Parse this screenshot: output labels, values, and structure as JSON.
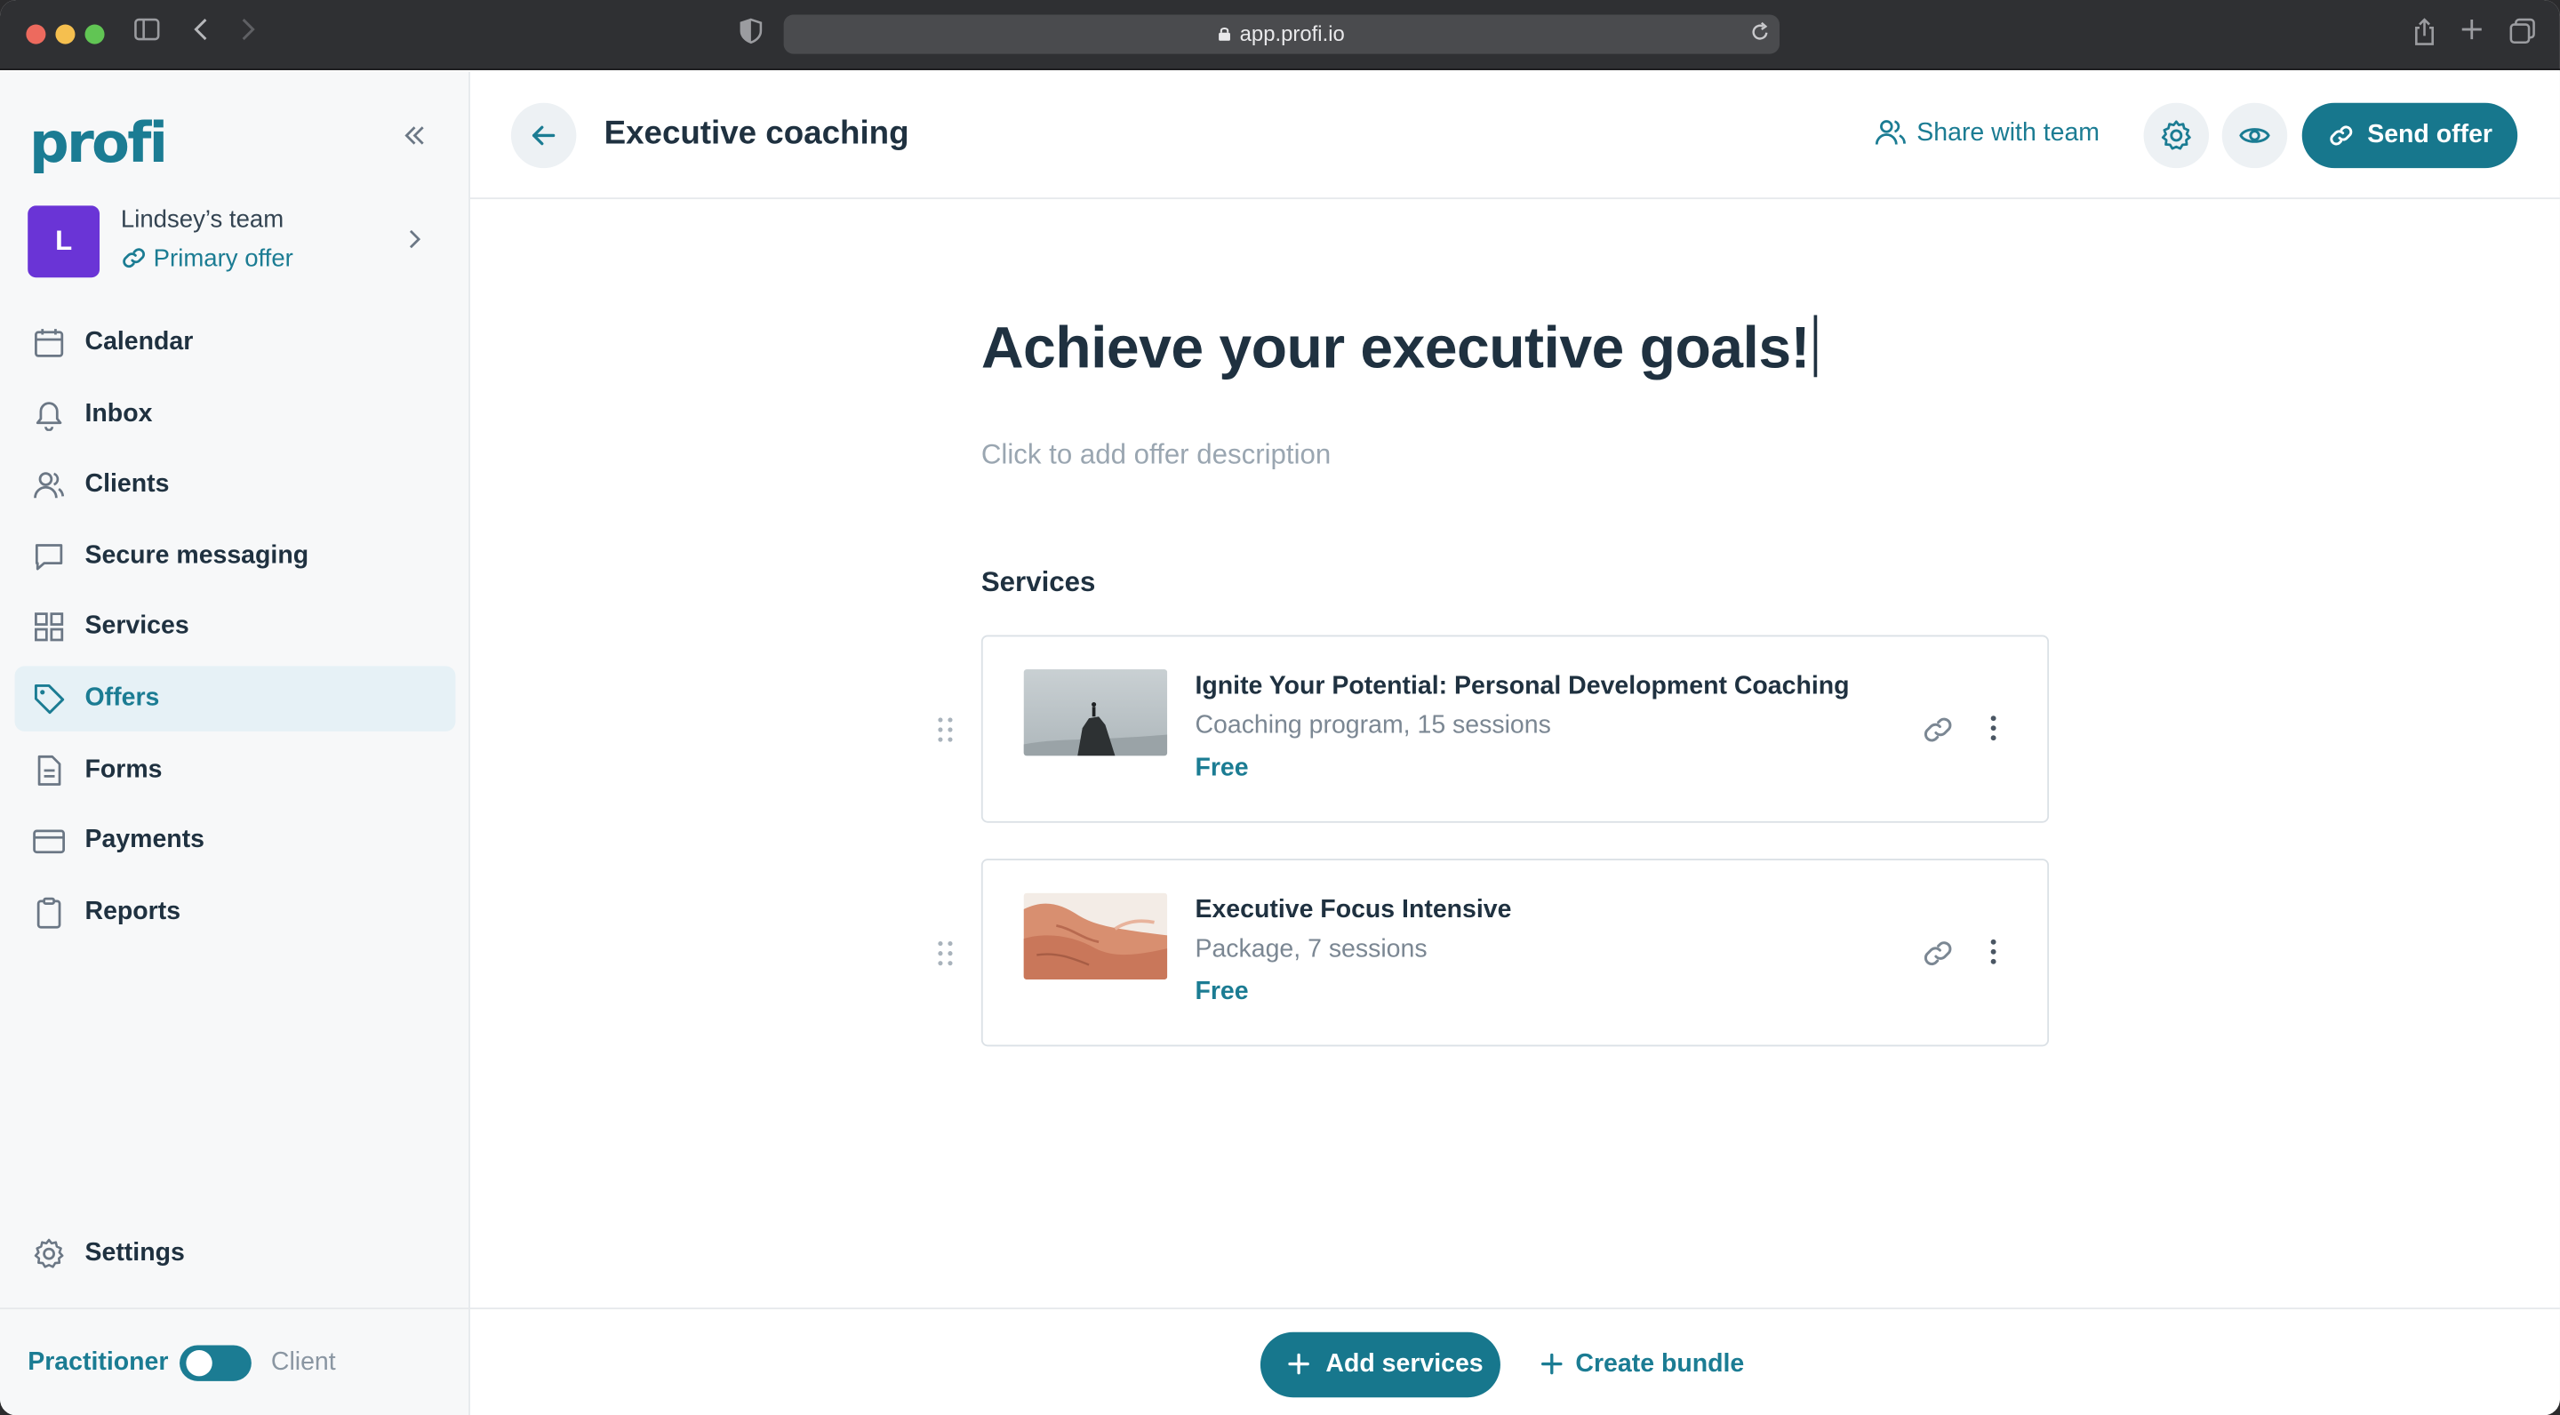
{
  "browser": {
    "url": "app.profi.io"
  },
  "sidebar": {
    "logo": "profi",
    "team": {
      "avatar_letter": "L",
      "name": "Lindsey’s team",
      "offer_link": "Primary offer"
    },
    "items": [
      {
        "label": "Calendar",
        "icon": "calendar-icon"
      },
      {
        "label": "Inbox",
        "icon": "bell-icon"
      },
      {
        "label": "Clients",
        "icon": "users-icon"
      },
      {
        "label": "Secure messaging",
        "icon": "chat-icon"
      },
      {
        "label": "Services",
        "icon": "grid-icon"
      },
      {
        "label": "Offers",
        "icon": "tag-icon",
        "active": true
      },
      {
        "label": "Forms",
        "icon": "document-icon"
      },
      {
        "label": "Payments",
        "icon": "card-icon"
      },
      {
        "label": "Reports",
        "icon": "clipboard-icon"
      }
    ],
    "settings_label": "Settings",
    "mode": {
      "practitioner": "Practitioner",
      "client": "Client"
    }
  },
  "header": {
    "title": "Executive coaching",
    "share_label": "Share with team",
    "send_label": "Send offer"
  },
  "offer": {
    "headline": "Achieve your executive goals!",
    "description_placeholder": "Click to add offer description",
    "services_heading": "Services",
    "services": [
      {
        "title": "Ignite Your Potential: Personal Development Coaching",
        "subtitle": "Coaching program, 15 sessions",
        "price": "Free",
        "image": "mountain-summit-image"
      },
      {
        "title": "Executive Focus Intensive",
        "subtitle": "Package, 7 sessions",
        "price": "Free",
        "image": "clasped-hands-image"
      }
    ]
  },
  "footer": {
    "add_services_label": "Add services",
    "create_bundle_label": "Create bundle"
  },
  "colors": {
    "accent": "#17778d",
    "avatar": "#6a34d6",
    "active_nav_bg": "#e6f1f6"
  }
}
